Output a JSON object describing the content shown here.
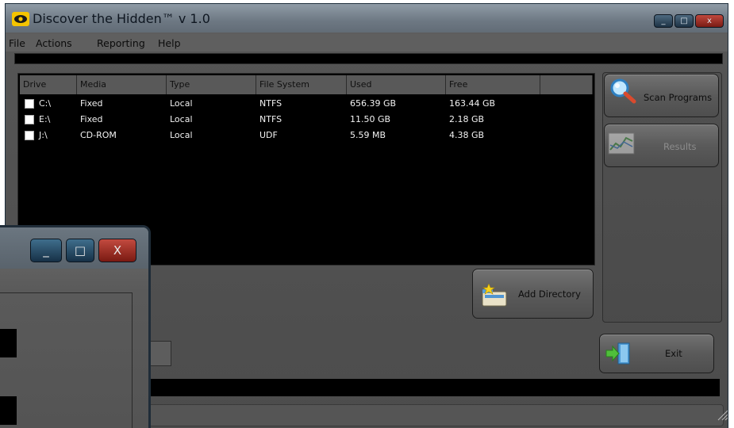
{
  "window": {
    "title": "Discover the Hidden™  v 1.0",
    "minimize_glyph": "_",
    "maximize_glyph": "□",
    "close_glyph": "x"
  },
  "menu": {
    "file": "File",
    "actions": "Actions",
    "reporting": "Reporting",
    "help": "Help"
  },
  "table": {
    "columns": [
      "Drive",
      "Media",
      "Type",
      "File System",
      "Used",
      "Free",
      ""
    ],
    "rows": [
      {
        "drive": "C:\\",
        "media": "Fixed",
        "type": "Local",
        "fs": "NTFS",
        "used": "656.39 GB",
        "free": "163.44 GB",
        "checked": false
      },
      {
        "drive": "E:\\",
        "media": "Fixed",
        "type": "Local",
        "fs": "NTFS",
        "used": "11.50 GB",
        "free": "2.18 GB",
        "checked": false
      },
      {
        "drive": "J:\\",
        "media": "CD-ROM",
        "type": "Local",
        "fs": "UDF",
        "used": "5.59 MB",
        "free": "4.38 GB",
        "checked": false
      }
    ]
  },
  "buttons": {
    "scan_programs": "Scan Programs",
    "results": "Results",
    "add_directory": "Add Directory",
    "exit": "Exit"
  },
  "second_window": {
    "minimize_glyph": "_",
    "maximize_glyph": "□",
    "close_glyph": "X"
  },
  "colors": {
    "window_bg": "#555555",
    "titlebar": "#6d7883",
    "list_bg": "#000000",
    "close_red": "#a0322a",
    "accent_blue": "#1d3245"
  },
  "icons": {
    "app": "eye-logo-icon",
    "scan": "magnifier-icon",
    "results": "chart-icon",
    "add_directory": "folder-star-icon",
    "exit": "exit-door-icon"
  }
}
